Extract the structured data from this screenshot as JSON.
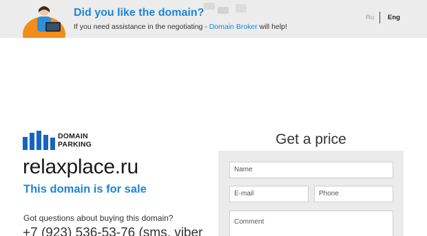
{
  "banner": {
    "headline": "Did you like the domain?",
    "subline_prefix": "If you need assistance in the negotiating - ",
    "broker_link": "Domain Broker",
    "subline_suffix": " will help!"
  },
  "languages": {
    "ru": "Ru",
    "en": "Eng"
  },
  "logo": {
    "line1": "DOMAIN",
    "line2": "PARKING"
  },
  "domain": {
    "name": "relaxplace.ru",
    "status": "This domain is for sale",
    "question": "Got questions about buying this domain?",
    "phone": "+7 (923) 536-53-76 (sms, viber"
  },
  "form": {
    "title": "Get a price",
    "name_placeholder": "Name",
    "email_placeholder": "E-mail",
    "phone_placeholder": "Phone",
    "comment_placeholder": "Comment"
  },
  "colors": {
    "accent": "#1c86d6",
    "banner_bg": "#ececec",
    "form_bg": "#ebebeb",
    "logo_blue": "#1565c0"
  }
}
